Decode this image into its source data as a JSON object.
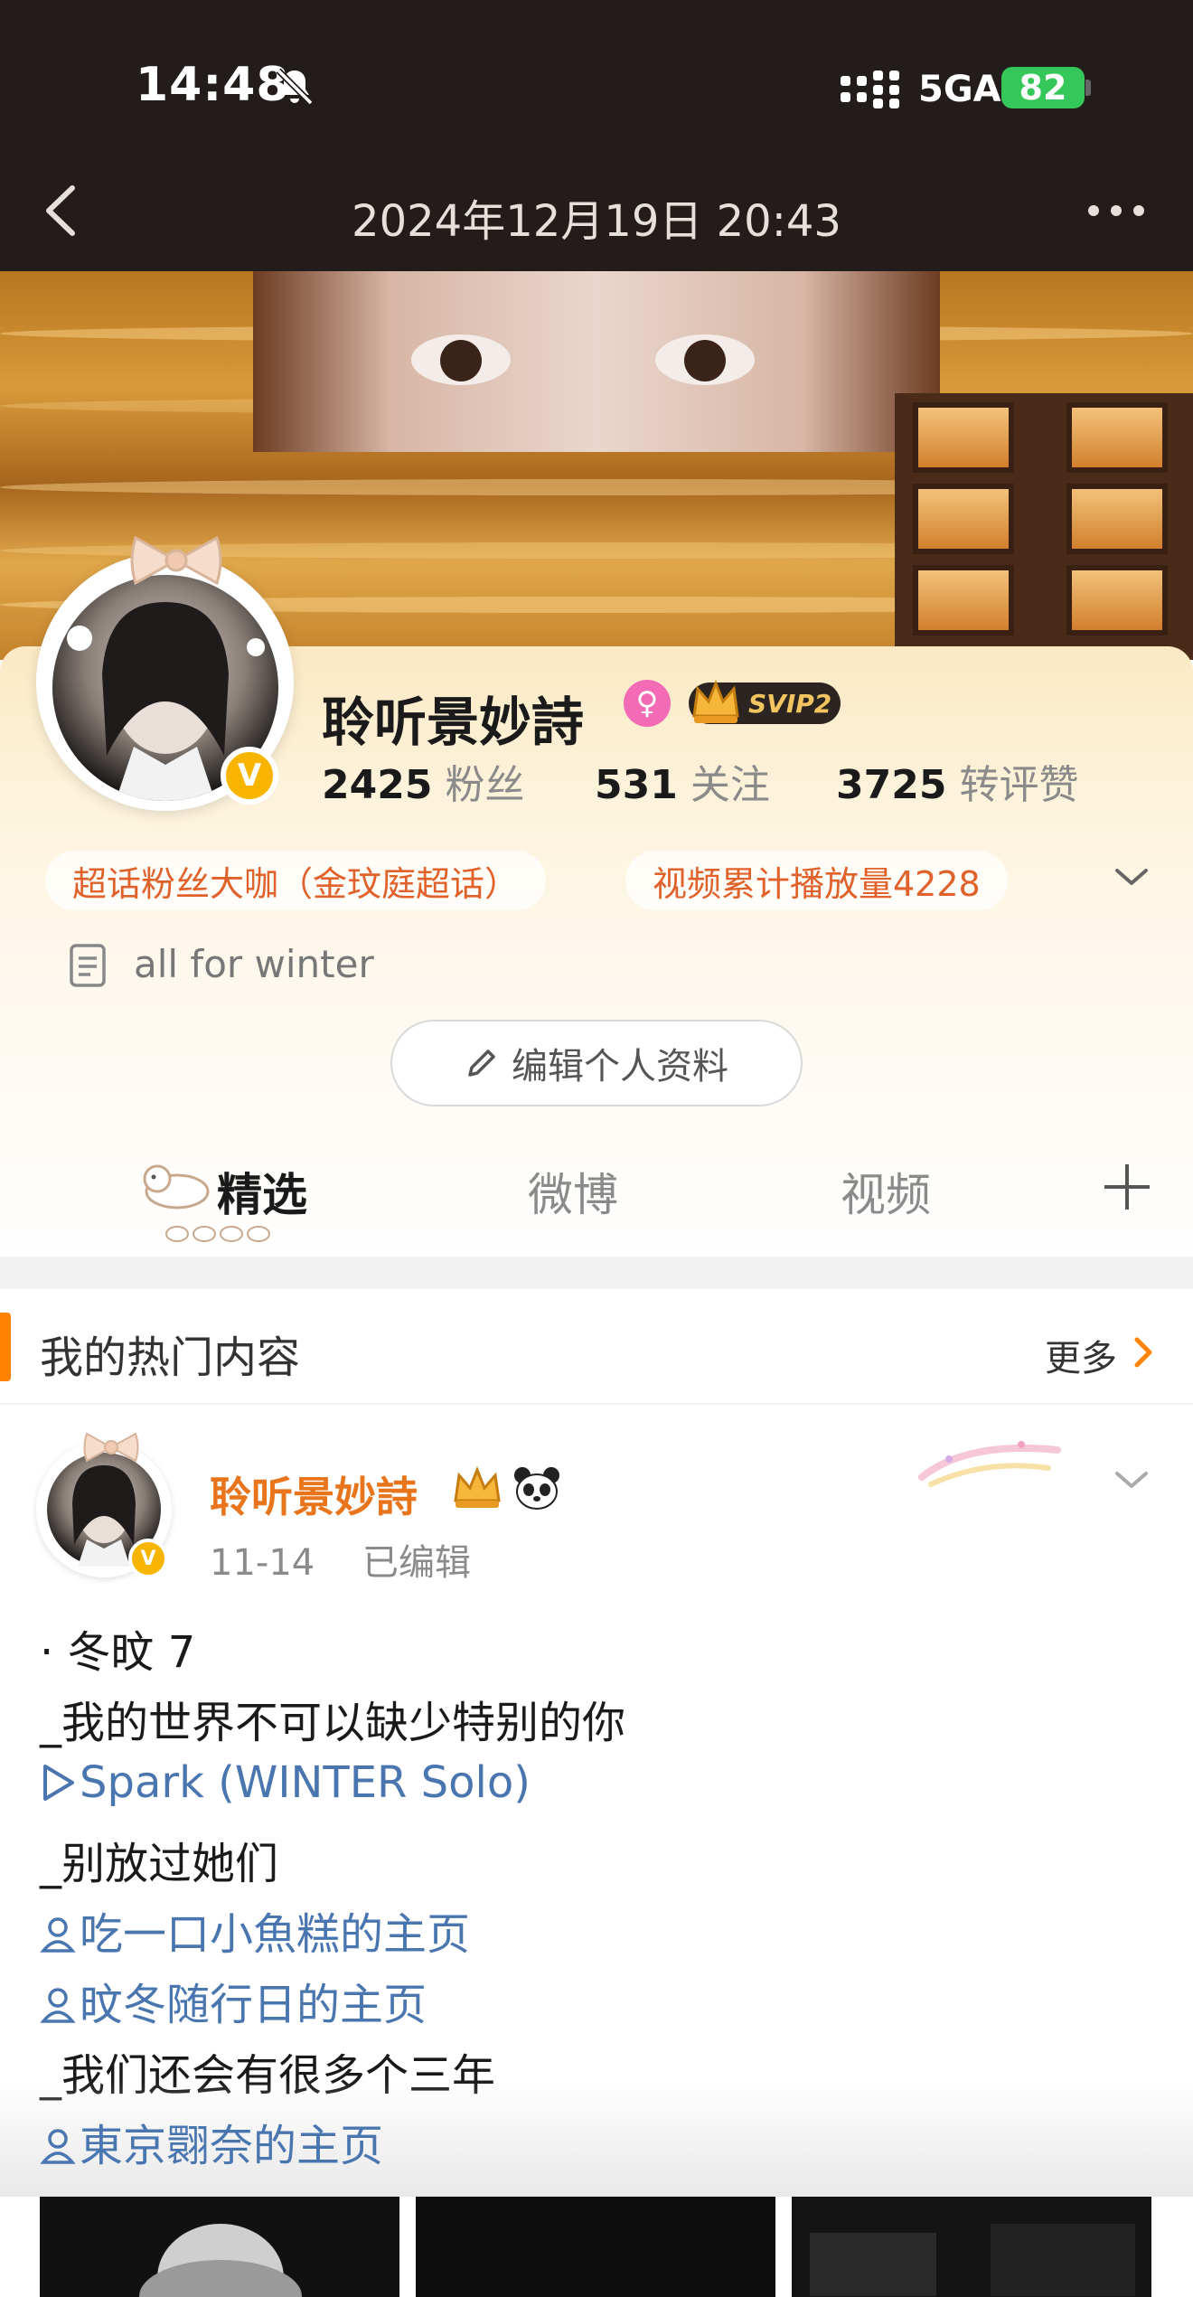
{
  "status_bar": {
    "time": "14:48",
    "network": "5GA",
    "battery": "82"
  },
  "nav": {
    "title": "2024年12月19日 20:43"
  },
  "profile": {
    "name": "聆听景妙詩",
    "badge_vip": "SVIP2",
    "stats": [
      {
        "value": "2425",
        "label": "粉丝"
      },
      {
        "value": "531",
        "label": "关注"
      },
      {
        "value": "3725",
        "label": "转评赞"
      }
    ],
    "tags": [
      "超话粉丝大咖（金玟庭超话）",
      "视频累计播放量4228"
    ],
    "bio": "all for winter",
    "edit_label": "编辑个人资料"
  },
  "tabs": [
    {
      "label": "精选",
      "active": true
    },
    {
      "label": "微博",
      "active": false
    },
    {
      "label": "视频",
      "active": false
    }
  ],
  "hot_section": {
    "title": "我的热门内容",
    "more": "更多"
  },
  "post": {
    "author": "聆听景妙詩",
    "date": "11-14",
    "edited": "已编辑",
    "lines": [
      {
        "text": "· 冬旼 7",
        "type": "text"
      },
      {
        "text": "_我的世界不可以缺少特别的你",
        "type": "text"
      },
      {
        "text": "Spark (WINTER Solo)",
        "type": "music-link"
      },
      {
        "text": "_别放过她们",
        "type": "text"
      },
      {
        "text": "吃一口小魚糕的主页",
        "type": "user-link"
      },
      {
        "text": "旼冬随行日的主页",
        "type": "user-link"
      },
      {
        "text": "_我们还会有很多个三年",
        "type": "text"
      },
      {
        "text": "東京翾奈的主页",
        "type": "user-link"
      }
    ]
  },
  "colors": {
    "accent": "#ff8200",
    "link": "#4a76b0",
    "name": "#e8741c",
    "tag": "#e0612a",
    "verify": "#f7b500"
  }
}
